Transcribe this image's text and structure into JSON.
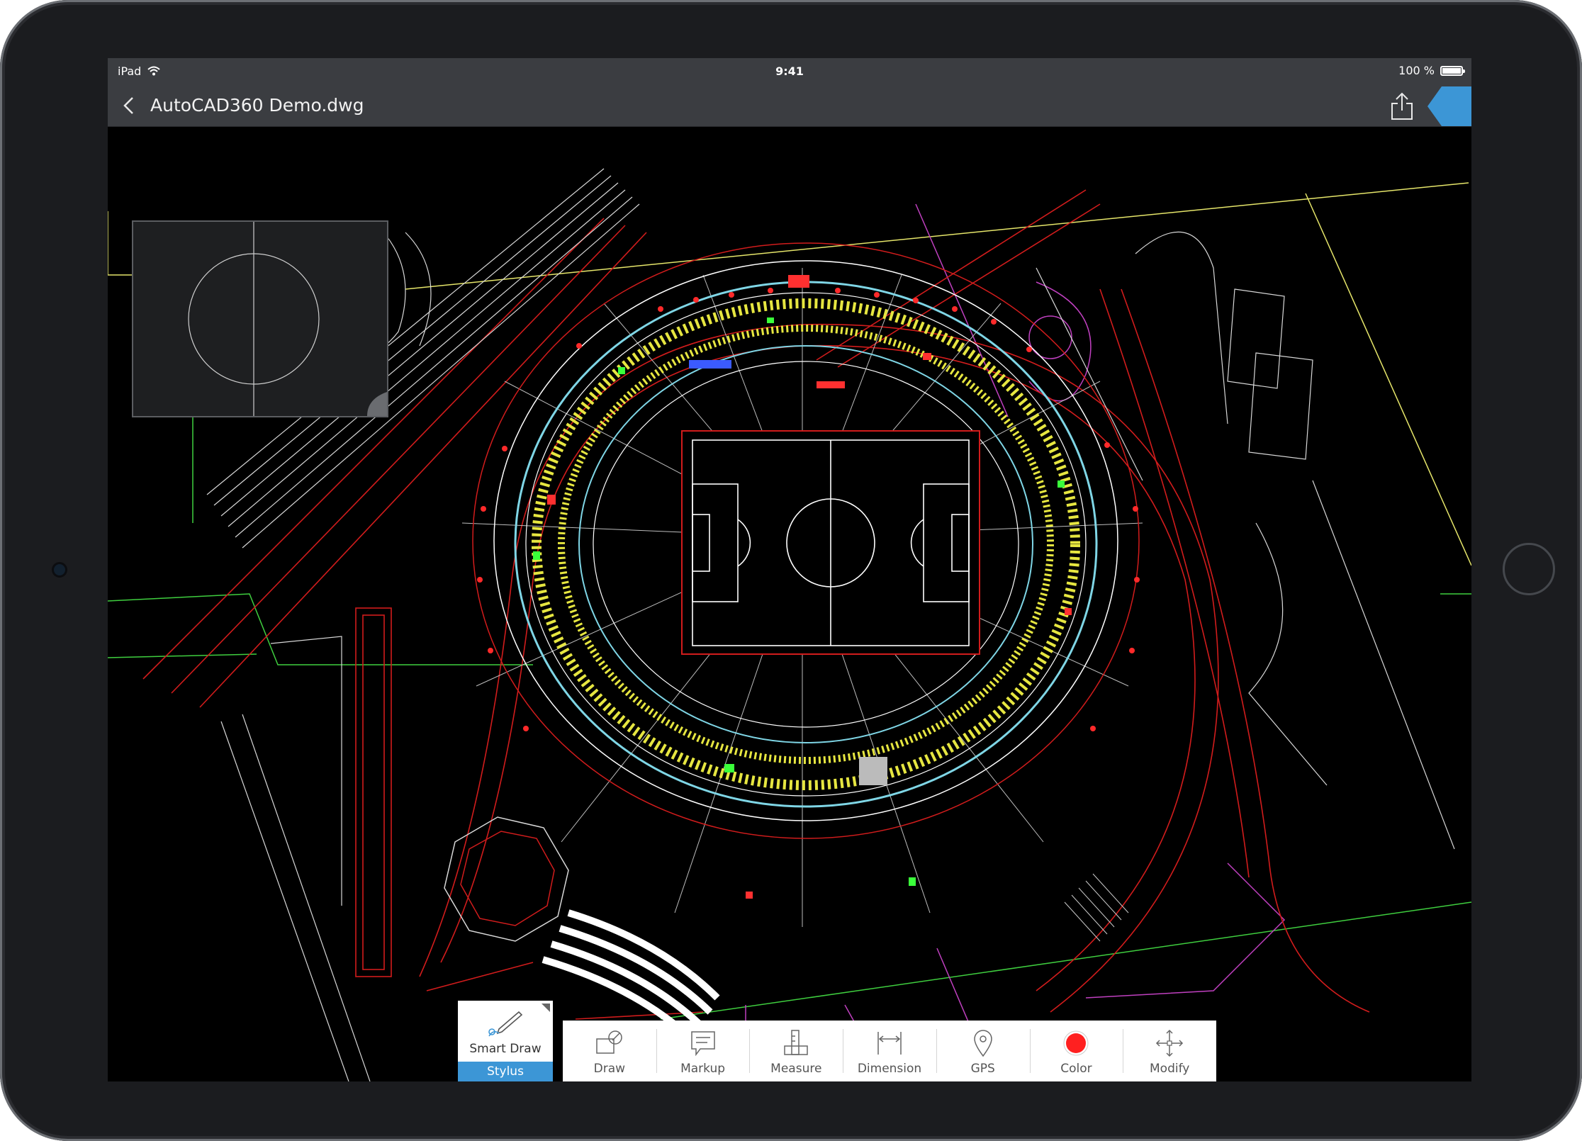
{
  "status": {
    "carrier": "iPad",
    "time": "9:41",
    "battery": "100 %"
  },
  "nav": {
    "title": "AutoCAD360 Demo.dwg"
  },
  "smart_draw": {
    "label": "Smart Draw",
    "sub": "Stylus"
  },
  "toolbar": {
    "tools": [
      {
        "label": "Draw",
        "icon": "draw-icon"
      },
      {
        "label": "Markup",
        "icon": "markup-icon"
      },
      {
        "label": "Measure",
        "icon": "measure-icon"
      },
      {
        "label": "Dimension",
        "icon": "dimension-icon"
      },
      {
        "label": "GPS",
        "icon": "gps-pin-icon"
      },
      {
        "label": "Color",
        "icon": "color-swatch-icon",
        "color": "#ff2020"
      },
      {
        "label": "Modify",
        "icon": "move-arrows-icon"
      }
    ]
  },
  "colors": {
    "accent": "#3c96d6",
    "bar": "#3b3d41",
    "canvas": "#000000"
  }
}
